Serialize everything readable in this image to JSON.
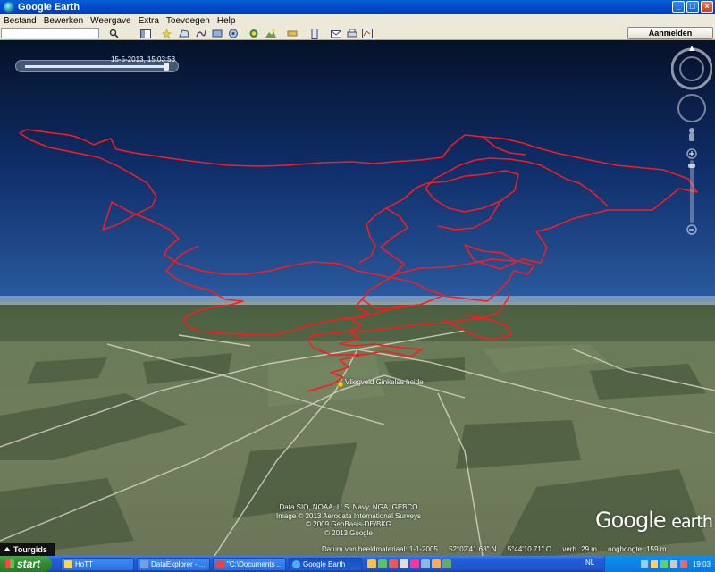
{
  "window": {
    "title": "Google Earth",
    "minimize": "_",
    "maximize": "□",
    "close": "×"
  },
  "menu": [
    "Bestand",
    "Bewerken",
    "Weergave",
    "Extra",
    "Toevoegen",
    "Help"
  ],
  "toolbar": {
    "search_value": "",
    "signin_label": "Aanmelden"
  },
  "time_slider": {
    "label": "15-5-2013, 15:03:53"
  },
  "placemark": {
    "label": "Vliegveld Ginkelse heide"
  },
  "credits": [
    "Data SIO, NOAA, U.S. Navy, NGA, GEBCO",
    "Image © 2013 Aerodata International Surveys",
    "© 2009 GeoBasis-DE/BKG",
    "© 2013 Google"
  ],
  "logo": {
    "word1": "Google",
    "word2": "earth"
  },
  "tour_guide": {
    "label": "Tourgids"
  },
  "status": {
    "imagery_date": "Datum van beeldmateriaal: 1-1-2005",
    "lat": "52°02'41.68\" N",
    "lon": "5°44'10.71\" O",
    "elev_label": "verh",
    "elev": "29 m",
    "eye_label": "ooghoogte",
    "eye": "159 m"
  },
  "taskbar": {
    "start_label": "start",
    "tasks": [
      "HoTT",
      "DataExplorer - ...",
      "\"C:\\Documents ...",
      "Google Earth"
    ],
    "lang": "NL",
    "clock": "19:03"
  },
  "colors": {
    "flight_track": "#ff1a1a",
    "sky_top": "#06112a",
    "horizon": "#a9c2dd"
  },
  "icons": [
    "search-icon",
    "sidebar-icon",
    "placemark-icon",
    "polygon-icon",
    "path-icon",
    "overlay-icon",
    "tour-icon",
    "sun-icon",
    "planets-icon",
    "ruler-icon",
    "email-icon",
    "print-icon",
    "maps-icon"
  ]
}
